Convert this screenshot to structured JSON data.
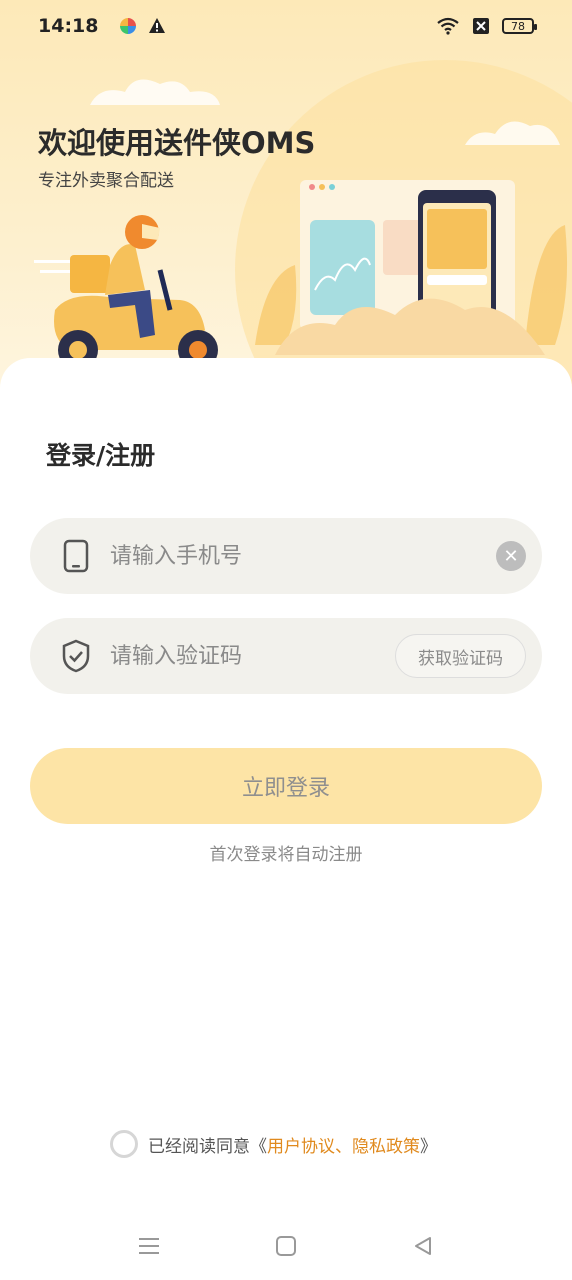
{
  "status_bar": {
    "time": "14:18",
    "battery": "78",
    "icons": [
      "app-icon",
      "warning-icon",
      "wifi-icon",
      "no-sim-icon",
      "battery-icon"
    ]
  },
  "hero": {
    "title": "欢迎使用送件侠OMS",
    "subtitle": "专注外卖聚合配送"
  },
  "login": {
    "section_title": "登录/注册",
    "phone_placeholder": "请输入手机号",
    "code_placeholder": "请输入验证码",
    "get_code_label": "获取验证码",
    "submit_label": "立即登录",
    "hint": "首次登录将自动注册"
  },
  "agreement": {
    "prefix": "已经阅读同意《",
    "links": "用户协议、隐私政策",
    "suffix": "》"
  },
  "colors": {
    "accent": "#e08a1e",
    "button_bg": "#fde4a6",
    "field_bg": "#f2f1ec",
    "hero_bg": "#fde9b8"
  },
  "nav": {
    "icons": [
      "menu-icon",
      "home-icon",
      "back-icon"
    ]
  }
}
